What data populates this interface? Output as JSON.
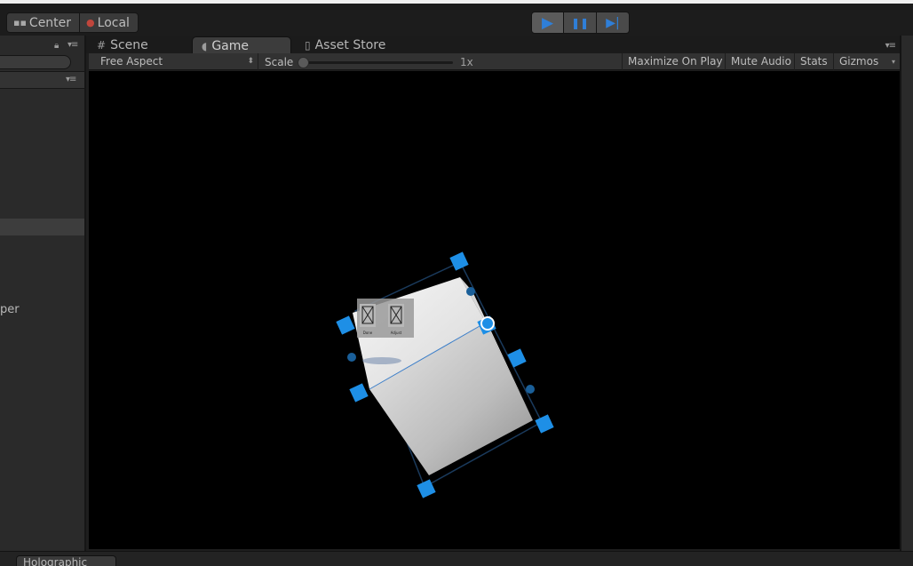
{
  "toolbar": {
    "pivot_center_label": "Center",
    "pivot_local_label": "Local",
    "play_icon": "▶",
    "pause_icon": "❚❚",
    "step_icon": "▶|"
  },
  "left_panel": {
    "partial_label": "per"
  },
  "tabs": [
    {
      "label": "Scene",
      "icon": "grid-icon"
    },
    {
      "label": "Game",
      "icon": "pacman-icon"
    },
    {
      "label": "Asset Store",
      "icon": "bag-icon"
    }
  ],
  "game_toolbar": {
    "aspect": "Free Aspect",
    "scale_label": "Scale",
    "scale_value": "1x",
    "maximize_on_play": "Maximize On Play",
    "mute_audio": "Mute Audio",
    "stats": "Stats",
    "gizmos": "Gizmos"
  },
  "scene": {
    "app_bar_buttons": [
      {
        "label": "Done",
        "icon": "image-placeholder-icon"
      },
      {
        "label": "Adjust",
        "icon": "image-placeholder-icon"
      }
    ]
  },
  "bottom": {
    "tab_label": "Holographic"
  },
  "colors": {
    "accent": "#2f7fd8",
    "handle": "#1e8fe6",
    "background": "#1e1e1e",
    "viewport": "#000000"
  }
}
